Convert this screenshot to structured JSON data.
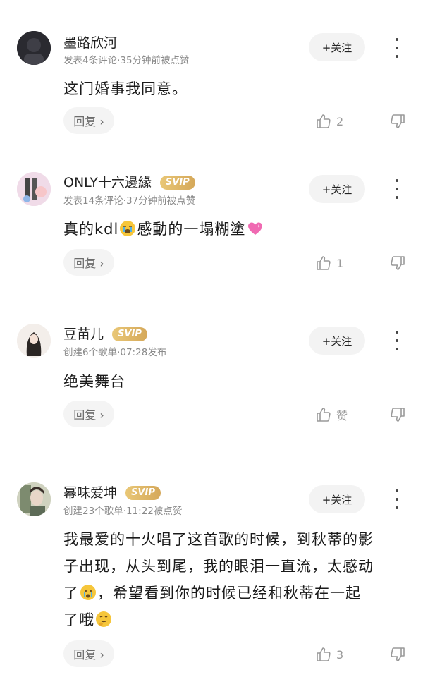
{
  "comments": [
    {
      "username": "墨路欣河",
      "vip": "",
      "meta": "发表4条评论·35分钟前被点赞",
      "follow_label": "+关注",
      "text_parts": [
        "这门婚事我同意。"
      ],
      "reply_label": "回复 ›",
      "like_count": "2",
      "avatar_color": "#1c1c22"
    },
    {
      "username": "ONLY十六邊緣",
      "vip": "SVIP",
      "meta": "发表14条评论·37分钟前被点赞",
      "follow_label": "+关注",
      "text_parts": [
        "真的kdl",
        "感動的一塌糊塗"
      ],
      "reply_label": "回复 ›",
      "like_count": "1",
      "avatar_color": "#e9d6e4"
    },
    {
      "username": "豆苗儿",
      "vip": "SVIP",
      "meta": "创建6个歌单·07:28发布",
      "follow_label": "+关注",
      "text_parts": [
        "绝美舞台"
      ],
      "reply_label": "回复 ›",
      "like_count": "赞",
      "avatar_color": "#f1ece8"
    },
    {
      "username": "幂味爱坤",
      "vip": "SVIP",
      "meta": "创建23个歌单·11:22被点赞",
      "follow_label": "+关注",
      "text_lines": [
        "我最爱的十火唱了这首歌的时候，到秋蒂的影",
        "子出现，从头到尾，我的眼泪一直流，太感动",
        "，希望看到你的时候已经和秋蒂在一起",
        "了哦"
      ],
      "line3_prefix": "了",
      "reply_label": "回复 ›",
      "like_count": "3",
      "avatar_color": "#c9cbb9"
    }
  ],
  "colors": {
    "vip": "#d9ad5f",
    "meta": "#8a8a8a",
    "emoji": "#f6c63b"
  }
}
